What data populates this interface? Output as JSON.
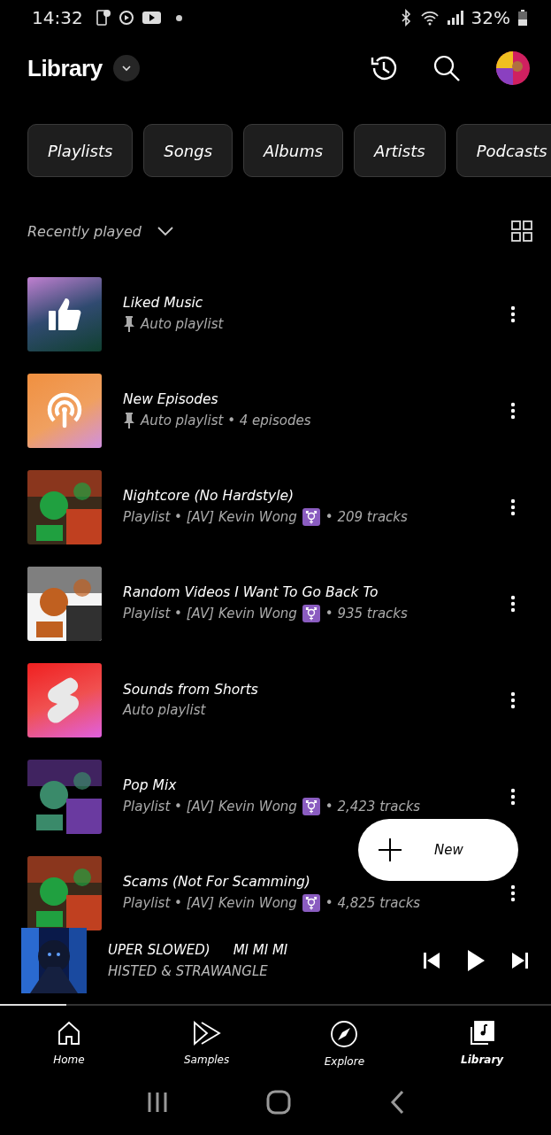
{
  "status_bar": {
    "time": "14:32",
    "battery": "32%"
  },
  "header": {
    "title": "Library"
  },
  "chips": [
    {
      "label": "Playlists",
      "selected": false
    },
    {
      "label": "Songs",
      "selected": false
    },
    {
      "label": "Albums",
      "selected": false
    },
    {
      "label": "Artists",
      "selected": false
    },
    {
      "label": "Podcasts",
      "selected": false
    }
  ],
  "sort": {
    "label": "Recently played"
  },
  "items": [
    {
      "title": "Liked Music",
      "kind": "liked",
      "pinned": true,
      "subtitle": "Auto playlist",
      "badge": false
    },
    {
      "title": "New Episodes",
      "kind": "podcast",
      "pinned": true,
      "subtitle": "Auto playlist • 4 episodes",
      "badge": false
    },
    {
      "title": "Nightcore (No Hardstyle)",
      "kind": "picture",
      "pinned": false,
      "subtitle": "Playlist • [AV] Kevin Wong",
      "badge": true,
      "count": "• 209 tracks"
    },
    {
      "title": "Random Videos I Want To Go Back To",
      "kind": "picture",
      "pinned": false,
      "subtitle": "Playlist • [AV] Kevin Wong",
      "badge": true,
      "count": "• 935 tracks"
    },
    {
      "title": "Sounds from Shorts",
      "kind": "shorts",
      "pinned": false,
      "subtitle": "Auto playlist",
      "badge": false
    },
    {
      "title": "Pop Mix",
      "kind": "picture",
      "pinned": false,
      "subtitle": "Playlist • [AV] Kevin Wong",
      "badge": true,
      "count": "• 2,423 tracks"
    },
    {
      "title": "Scams (Not For Scamming)",
      "kind": "picture",
      "pinned": false,
      "subtitle": "Playlist • [AV] Kevin Wong",
      "badge": true,
      "count": "• 4,825 tracks"
    }
  ],
  "fab": {
    "label": "New"
  },
  "player": {
    "title": "UPER SLOWED)",
    "title_next": "MI MI MI",
    "artist": "HISTED & STRAWANGLE",
    "level": 0.12
  },
  "nav": [
    {
      "label": "Home",
      "selected": false
    },
    {
      "label": "Samples",
      "selected": false
    },
    {
      "label": "Explore",
      "selected": false
    },
    {
      "label": "Library",
      "selected": true
    }
  ]
}
